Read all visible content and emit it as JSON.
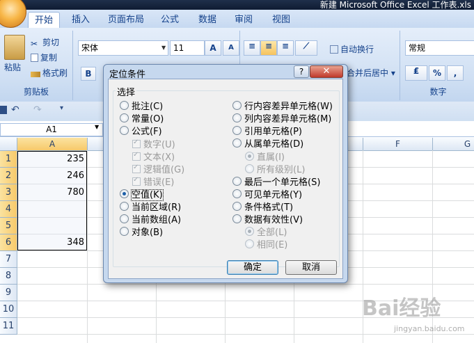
{
  "window": {
    "title": "新建 Microsoft Office Excel 工作表.xls"
  },
  "ribbon": {
    "tabs": [
      "开始",
      "插入",
      "页面布局",
      "公式",
      "数据",
      "审阅",
      "视图"
    ],
    "clipboard": {
      "paste": "粘贴",
      "cut": "剪切",
      "copy": "复制",
      "format_painter": "格式刷",
      "group": "剪贴板"
    },
    "font": {
      "name": "宋体",
      "size": "11",
      "bold": "B",
      "grow": "A",
      "shrink": "A"
    },
    "alignment": {
      "wrap": "自动换行",
      "merge": "合并后居中"
    },
    "number": {
      "format": "常规",
      "percent": "%",
      "comma": ",",
      "group": "数字"
    }
  },
  "formula_bar": {
    "name_box": "A1"
  },
  "grid": {
    "columns": [
      "A",
      "F",
      "G"
    ],
    "rows": [
      "1",
      "2",
      "3",
      "4",
      "5",
      "6",
      "7",
      "8",
      "9",
      "10",
      "11"
    ],
    "cells": [
      "235",
      "246",
      "780",
      "",
      "",
      "348"
    ]
  },
  "dialog": {
    "title": "定位条件",
    "help": "?",
    "close": "✕",
    "section": "选择",
    "left_options": [
      "批注(C)",
      "常量(O)",
      "公式(F)",
      "数字(U)",
      "文本(X)",
      "逻辑值(G)",
      "错误(E)",
      "空值(K)",
      "当前区域(R)",
      "当前数组(A)",
      "对象(B)"
    ],
    "right_options": [
      "行内容差异单元格(W)",
      "列内容差异单元格(M)",
      "引用单元格(P)",
      "从属单元格(D)",
      "直属(I)",
      "所有级别(L)",
      "最后一个单元格(S)",
      "可见单元格(Y)",
      "条件格式(T)",
      "数据有效性(V)",
      "全部(L)",
      "相同(E)"
    ],
    "selected": "空值(K)",
    "ok": "确定",
    "cancel": "取消"
  },
  "watermark": {
    "logo": "Bai经验",
    "url": "jingyan.baidu.com"
  }
}
